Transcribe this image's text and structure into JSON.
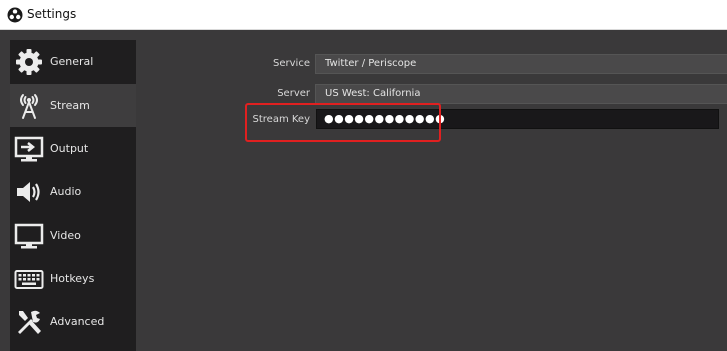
{
  "window": {
    "title": "Settings",
    "app_icon": "obs-logo-icon"
  },
  "sidebar": {
    "items": [
      {
        "label": "General",
        "icon": "gear-icon",
        "selected": false
      },
      {
        "label": "Stream",
        "icon": "broadcast-antenna-icon",
        "selected": true
      },
      {
        "label": "Output",
        "icon": "output-monitor-icon",
        "selected": false
      },
      {
        "label": "Audio",
        "icon": "speaker-icon",
        "selected": false
      },
      {
        "label": "Video",
        "icon": "monitor-icon",
        "selected": false
      },
      {
        "label": "Hotkeys",
        "icon": "keyboard-icon",
        "selected": false
      },
      {
        "label": "Advanced",
        "icon": "tools-icon",
        "selected": false
      }
    ]
  },
  "stream": {
    "service_label": "Service",
    "service_value": "Twitter / Periscope",
    "server_label": "Server",
    "server_value": "US West: California",
    "key_label": "Stream Key",
    "key_value": "●●●●●●●●●●●●"
  },
  "colors": {
    "highlight": "#e02020",
    "sidebar_bg": "#1f1e1f",
    "content_bg": "#3a393a"
  }
}
